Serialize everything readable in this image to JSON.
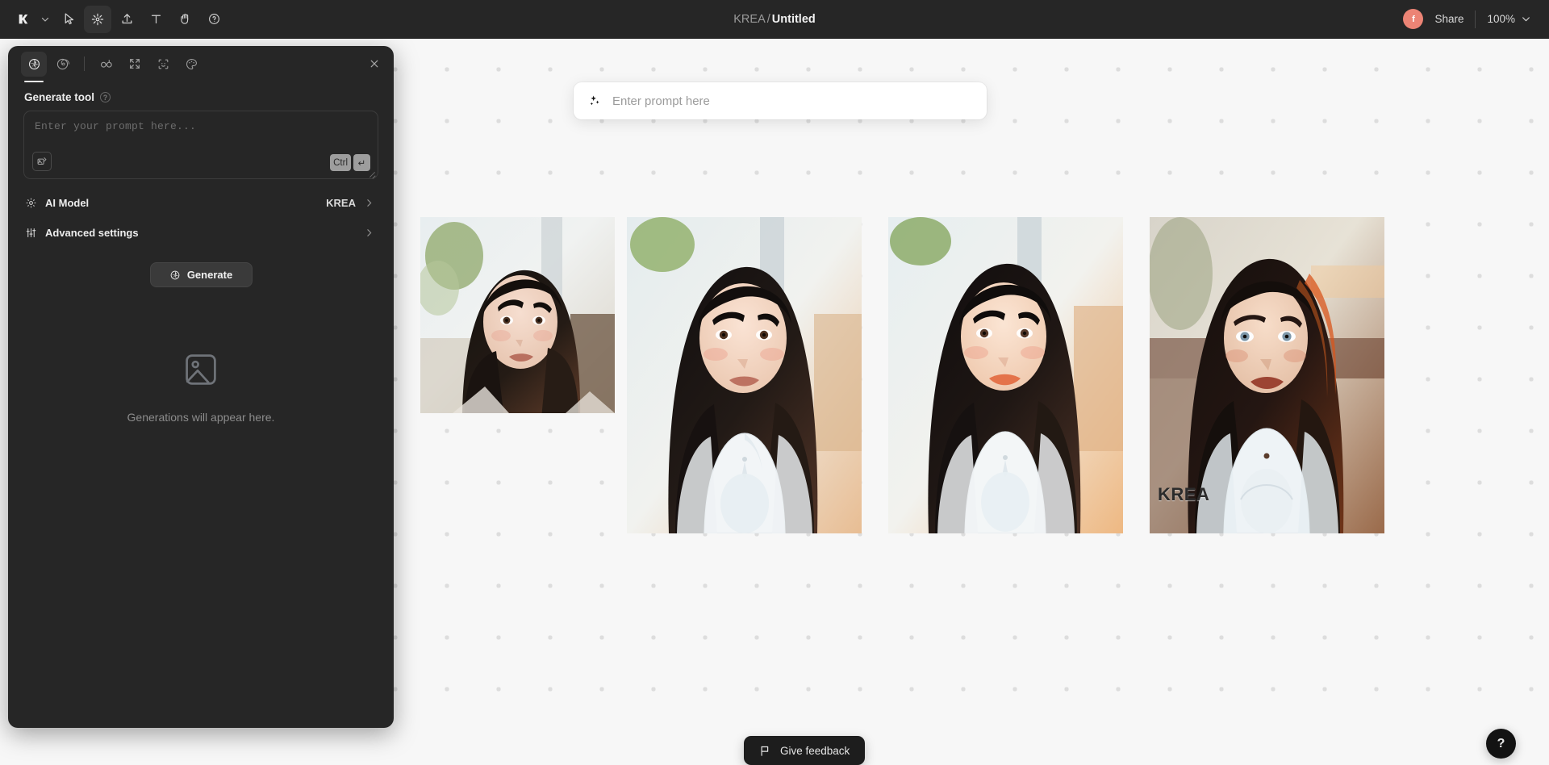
{
  "topbar": {
    "logo_icon": "krea-logo-icon",
    "caret_icon": "chevron-down-icon",
    "tools": [
      {
        "id": "select",
        "icon": "cursor-arrow-icon",
        "active": false
      },
      {
        "id": "generate",
        "icon": "sparkle-aperture-icon",
        "active": true
      },
      {
        "id": "upload",
        "icon": "upload-icon",
        "active": false
      },
      {
        "id": "text",
        "icon": "text-t-icon",
        "active": false
      },
      {
        "id": "hand",
        "icon": "hand-pan-icon",
        "active": false
      },
      {
        "id": "help",
        "icon": "question-circle-icon",
        "active": false
      }
    ],
    "title_project": "KREA",
    "title_separator": "/",
    "title_document": "Untitled",
    "avatar_initial": "f",
    "avatar_color": "#ec8475",
    "share_label": "Share",
    "zoom_value": "100%",
    "zoom_caret_icon": "chevron-down-icon"
  },
  "panel": {
    "tabs": [
      {
        "id": "generate",
        "icon": "aperture-icon",
        "active": true
      },
      {
        "id": "enhance",
        "icon": "spiral-icon",
        "active": false
      },
      {
        "id": "realtime",
        "icon": "glasses-icon",
        "active": false
      },
      {
        "id": "upscale",
        "icon": "expand-arrows-icon",
        "active": false
      },
      {
        "id": "faceswap",
        "icon": "smiley-face-icon",
        "active": false
      },
      {
        "id": "style",
        "icon": "palette-icon",
        "active": false
      }
    ],
    "close_icon": "close-icon",
    "title": "Generate tool",
    "title_help_icon": "help-circle-icon",
    "prompt_placeholder": "Enter your prompt here...",
    "prompt_value": "",
    "prompt_image_icon": "add-image-icon",
    "kbd_modifier": "Ctrl",
    "kbd_enter": "↵",
    "rows": [
      {
        "id": "ai-model",
        "icon": "gear-icon",
        "label": "AI Model",
        "value": "KREA",
        "chevron": "chevron-right-icon"
      },
      {
        "id": "advanced-settings",
        "icon": "sliders-icon",
        "label": "Advanced settings",
        "value": "",
        "chevron": "chevron-right-icon"
      }
    ],
    "generate_button": {
      "label": "Generate",
      "icon": "aperture-icon"
    },
    "empty_state": {
      "icon": "image-placeholder-icon",
      "text": "Generations will appear here."
    }
  },
  "floating_prompt": {
    "icon": "sparkles-icon",
    "placeholder": "Enter prompt here",
    "value": ""
  },
  "canvas": {
    "background_color": "#f7f7f7",
    "dot_color": "#dddddd",
    "images": [
      {
        "id": "generation-1",
        "alt": "Portrait of a woman with dark bob hair in a cafe, soft daylight",
        "watermark": ""
      },
      {
        "id": "generation-2",
        "alt": "Portrait of a woman with dark bob hair wearing white lace top",
        "watermark": ""
      },
      {
        "id": "generation-3",
        "alt": "Portrait of a woman with dark bob hair, warm tones, white lace top",
        "watermark": ""
      },
      {
        "id": "generation-4",
        "alt": "Portrait of a woman with dark hair and blue eyes in white lace top",
        "watermark": "KREA"
      }
    ]
  },
  "footer": {
    "feedback_label": "Give feedback",
    "feedback_icon": "flag-icon",
    "help_fab_label": "?"
  }
}
